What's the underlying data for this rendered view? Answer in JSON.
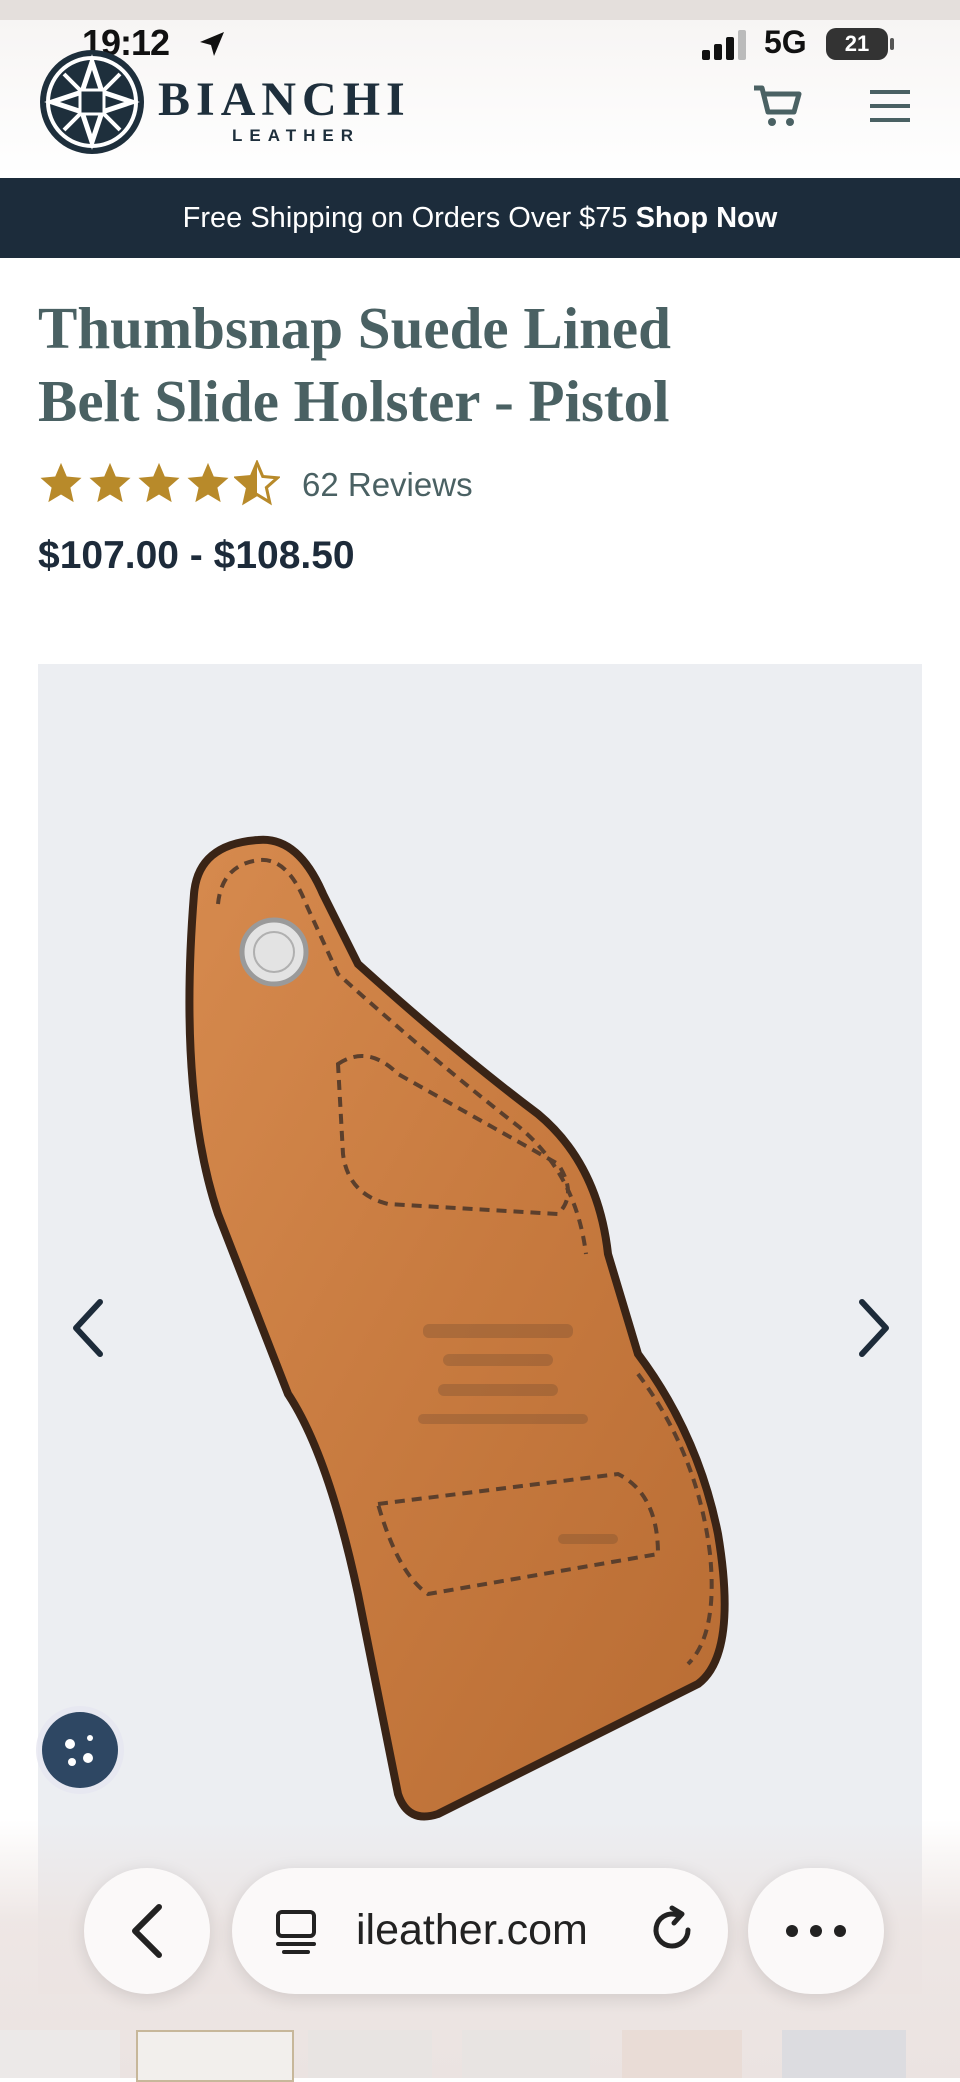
{
  "status_bar": {
    "time": "19:12",
    "network": "5G",
    "battery": "21"
  },
  "brand": {
    "name": "BIANCHI",
    "sub": "LEATHER"
  },
  "promo": {
    "text": "Free Shipping on Orders Over $75",
    "link": "Shop Now"
  },
  "product": {
    "title_line1": "Thumbsnap Suede Lined",
    "title_line2": "Belt Slide Holster - Pistol",
    "rating": 4.5,
    "reviews_label": "62 Reviews",
    "price_range": "$107.00 - $108.50"
  },
  "browser": {
    "url": "ileather.com"
  },
  "colors": {
    "navy": "#1c2c3b",
    "title": "#4a6163",
    "star": "#b88a2a"
  }
}
